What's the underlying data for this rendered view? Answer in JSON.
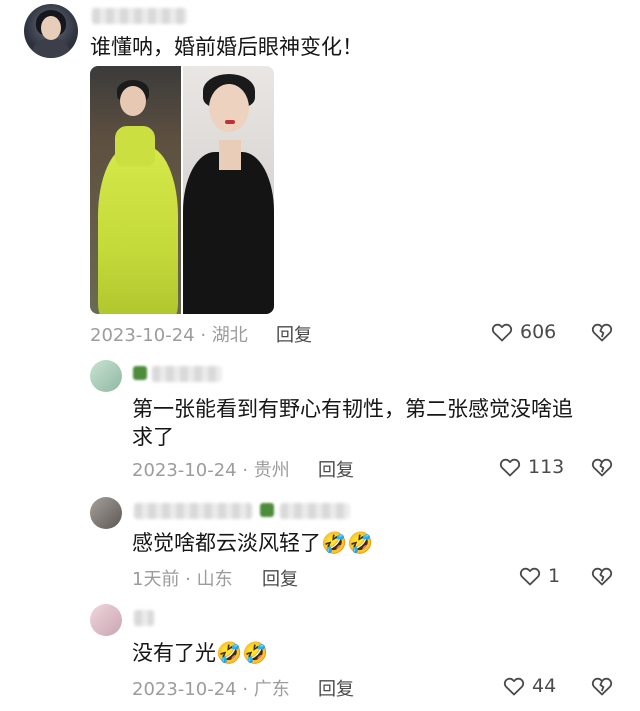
{
  "comments": [
    {
      "text": "谁懂呐，婚前婚后眼神变化！",
      "date_location": "2023-10-24 · 湖北",
      "reply_label": "回复",
      "likes": "606"
    },
    {
      "text_line1": "第一张能看到有野心有韧性，第二张感觉没啥追",
      "text_line2": "求了",
      "date_location": "2023-10-24 · 贵州",
      "reply_label": "回复",
      "likes": "113"
    },
    {
      "text": "感觉啥都云淡风轻了🤣🤣",
      "date_location": "1天前 · 山东",
      "reply_label": "回复",
      "likes": "1"
    },
    {
      "text": "没有了光🤣🤣",
      "date_location": "2023-10-24 · 广东",
      "reply_label": "回复",
      "likes": "44"
    }
  ],
  "icons": {
    "like": "heart-outline-icon",
    "dislike": "broken-heart-icon"
  },
  "colors": {
    "meta_text": "#9c9c9c",
    "body_text": "#161616"
  }
}
